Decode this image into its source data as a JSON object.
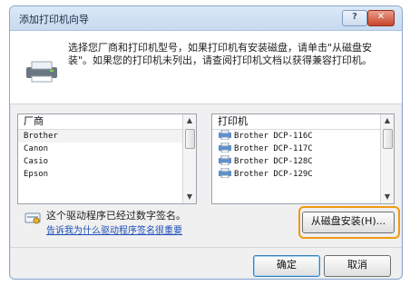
{
  "window": {
    "title": "添加打印机向导"
  },
  "title_buttons": {
    "help": "?",
    "close": "✕"
  },
  "intro": {
    "text": "选择您厂商和打印机型号，如果打印机有安装磁盘，请单击\"从磁盘安装\"。如果您的打印机未列出，请查阅打印机文档以获得兼容打印机。"
  },
  "manufacturers": {
    "header": "厂商",
    "items": [
      "Brother",
      "Canon",
      "Casio",
      "Epson"
    ]
  },
  "printers": {
    "header": "打印机",
    "items": [
      "Brother DCP-116C",
      "Brother DCP-117C",
      "Brother DCP-128C",
      "Brother DCP-129C"
    ]
  },
  "signature": {
    "text": "这个驱动程序已经过数字签名。",
    "link": "告诉我为什么驱动程序签名很重要"
  },
  "buttons": {
    "have_disk": "从磁盘安装(H)...",
    "ok": "确定",
    "cancel": "取消"
  },
  "colors": {
    "highlight": "#f09a12",
    "link": "#1b4db8"
  }
}
